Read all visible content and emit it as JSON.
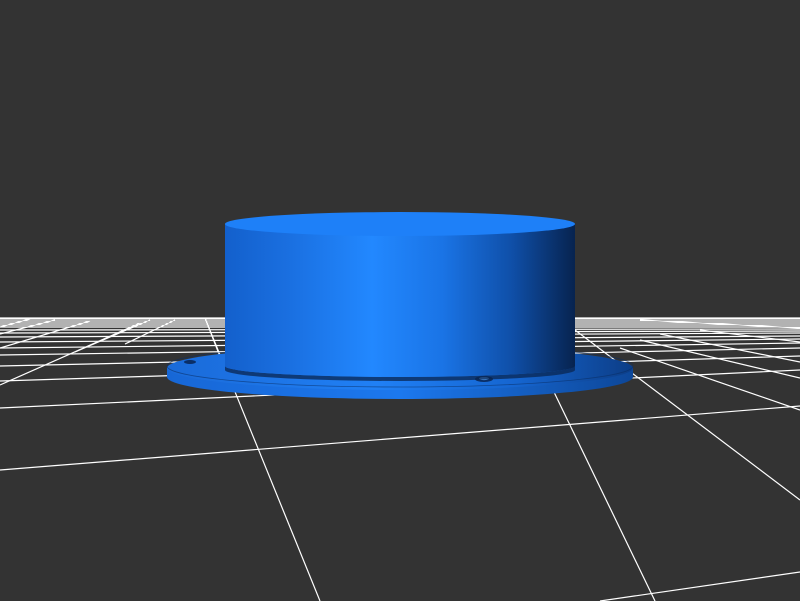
{
  "viewer": {
    "background_color": "#333333",
    "grid_color": "#ffffff",
    "grid_visible": true
  },
  "model": {
    "shape": "flanged cylindrical cup",
    "color": "#1f7ff0",
    "color_dark": "#0a2e66",
    "mounting_holes_visible": 2
  }
}
